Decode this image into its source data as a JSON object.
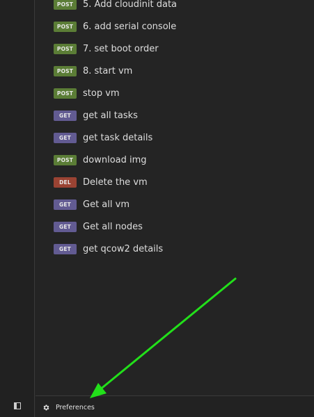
{
  "requests": [
    {
      "method": "POST",
      "name": "5. Add cloudinit data"
    },
    {
      "method": "POST",
      "name": "6. add serial console"
    },
    {
      "method": "POST",
      "name": "7. set boot order"
    },
    {
      "method": "POST",
      "name": "8. start vm"
    },
    {
      "method": "POST",
      "name": "stop vm"
    },
    {
      "method": "GET",
      "name": "get all tasks"
    },
    {
      "method": "GET",
      "name": "get task details"
    },
    {
      "method": "POST",
      "name": "download img"
    },
    {
      "method": "DEL",
      "name": "Delete the vm"
    },
    {
      "method": "GET",
      "name": "Get all vm"
    },
    {
      "method": "GET",
      "name": "Get all nodes"
    },
    {
      "method": "GET",
      "name": "get qcow2 details"
    }
  ],
  "footer": {
    "preferences_label": "Preferences",
    "preferences_icon": "gear-icon",
    "sidebar_toggle_icon": "sidebar-toggle-icon"
  },
  "colors": {
    "post": "#5b7d36",
    "get": "#625b92",
    "del": "#9a4333",
    "annotation_arrow": "#22e01a"
  }
}
